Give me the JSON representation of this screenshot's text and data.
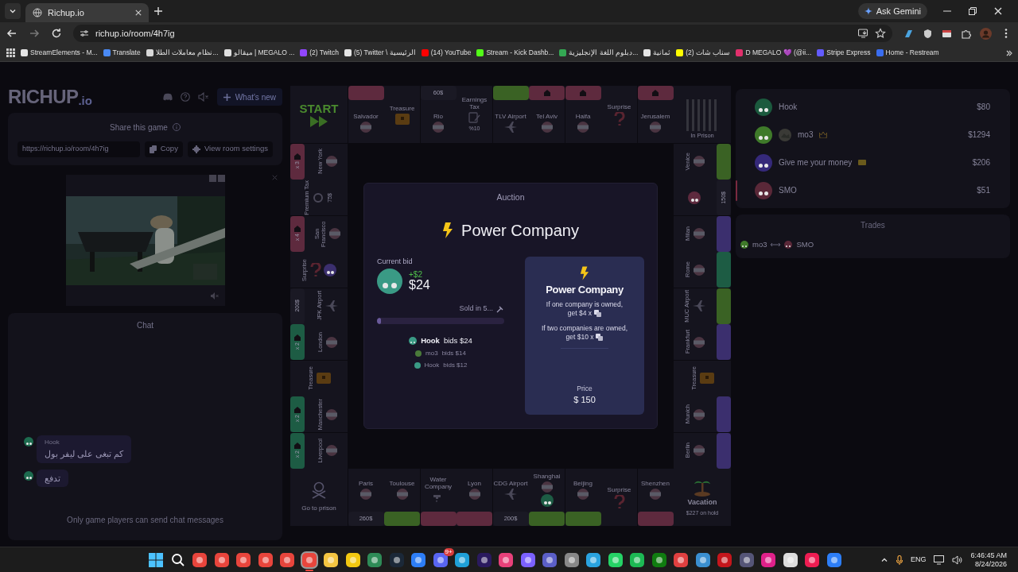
{
  "browser": {
    "tab": {
      "title": "Richup.io",
      "selected": true
    },
    "ask_button": "Ask Gemini",
    "url": "richup.io/room/4h7ig",
    "bookmarks": [
      {
        "label": "StreamElements - M...",
        "color": "#e5e5e5"
      },
      {
        "label": "Translate",
        "color": "#4a8af4"
      },
      {
        "label": "نظام معاملات الطلا...",
        "color": "#d8d8d8"
      },
      {
        "label": "ميقالو | MEGALO ...",
        "color": "#e0e0e0"
      },
      {
        "label": "(2) Twitch",
        "color": "#9146ff"
      },
      {
        "label": "(5) Twitter \\ الرئيسية",
        "color": "#e5e5e5"
      },
      {
        "label": "(14) YouTube",
        "color": "#ff0000"
      },
      {
        "label": "Stream - Kick Dashb...",
        "color": "#53fc18"
      },
      {
        "label": "دبلوم اللغة الإنجليزية...",
        "color": "#34a853"
      },
      {
        "label": "ثمانية",
        "color": "#e5e5e5"
      },
      {
        "label": "(2) سناب شات",
        "color": "#fffc00"
      },
      {
        "label": "D MEGALO 💜 (@ii...",
        "color": "#e1306c"
      },
      {
        "label": "Stripe Express",
        "color": "#635bff"
      },
      {
        "label": "Home - Restream",
        "color": "#3a6df0"
      }
    ]
  },
  "app": {
    "logo": {
      "main": "RICHUP",
      "suffix": ".io"
    },
    "whats_new": "What's new",
    "share": {
      "title": "Share this game",
      "url": "https://richup.io/room/4h7ig",
      "copy": "Copy",
      "settings": "View room settings"
    },
    "chat": {
      "title": "Chat",
      "messages": [
        {
          "author": "Hook",
          "text": "كم تبغى على ليفر بول",
          "color": "#1d6b4f"
        },
        {
          "text": "تدفع",
          "color": "#1d6b4f"
        }
      ],
      "notice": "Only game players can send chat messages"
    },
    "board": {
      "corners": {
        "start": "START",
        "prison": "In Prison",
        "go_to_prison": "Go to prison",
        "vacation": "Vacation",
        "vacation_note": "$227 on hold"
      },
      "top": [
        {
          "name": "Salvador",
          "band": {
            "color": "#5e2a3e",
            "house": false
          },
          "kind": "flag"
        },
        {
          "name": "Treasure",
          "kind": "chest"
        },
        {
          "name": "Rio",
          "band": {
            "text": "60$",
            "house": false
          },
          "kind": "flag"
        },
        {
          "name": "Earnings Tax",
          "kind": "tax",
          "note": "%10"
        },
        {
          "name": "TLV Airport",
          "band": {
            "color": "#3a6224",
            "house": false
          },
          "kind": "plane"
        },
        {
          "name": "Tel Aviv",
          "band": {
            "color": "#5e2a3e",
            "house": true
          },
          "kind": "flag"
        },
        {
          "name": "Haifa",
          "band": {
            "color": "#5e2a3e",
            "house": true
          },
          "kind": "flag"
        },
        {
          "name": "Surprise",
          "kind": "question"
        },
        {
          "name": "Jerusalem",
          "band": {
            "color": "#5e2a3e",
            "house": true
          },
          "kind": "flag"
        }
      ],
      "left": [
        {
          "name": "New York",
          "band": {
            "color": "#5e2a3e",
            "house": true,
            "text": "x 3"
          },
          "kind": "flag"
        },
        {
          "name": "Premium Tax",
          "kind": "ring",
          "note": "75$"
        },
        {
          "name": "San Francisco",
          "band": {
            "color": "#5e2a3e",
            "house": true,
            "text": "x 4"
          },
          "kind": "flag"
        },
        {
          "name": "Surprise",
          "kind": "question",
          "token": {
            "color": "#3b2f6e"
          }
        },
        {
          "name": "JFK Airport",
          "band": {
            "text": "200$",
            "house": false
          },
          "kind": "plane"
        },
        {
          "name": "London",
          "band": {
            "color": "#1d5c44",
            "house": true,
            "text": "x 2"
          },
          "kind": "flag"
        },
        {
          "name": "Treasure",
          "kind": "chest"
        },
        {
          "name": "Manchester",
          "band": {
            "color": "#1d5c44",
            "house": true,
            "text": "x 2"
          },
          "kind": "flag"
        },
        {
          "name": "Liverpool",
          "band": {
            "color": "#1d5c44",
            "house": true,
            "text": "x 2"
          },
          "kind": "flag"
        }
      ],
      "right": [
        {
          "name": "Venice",
          "band": {
            "color": "#3a6224",
            "house": false
          },
          "kind": "flag"
        },
        {
          "band": {
            "text": "150$",
            "house": false
          },
          "token": {
            "color": "#5e2a3e"
          }
        },
        {
          "name": "Milan",
          "band": {
            "color": "#3b2f6e",
            "house": false
          },
          "kind": "flag"
        },
        {
          "name": "Rome",
          "band": {
            "color": "#1d5c44",
            "house": false
          },
          "kind": "flag"
        },
        {
          "name": "MUC Airport",
          "band": {
            "color": "#3a6224",
            "house": false
          },
          "kind": "plane"
        },
        {
          "name": "Frankfurt",
          "band": {
            "color": "#3b2f6e",
            "house": false
          },
          "kind": "flag"
        },
        {
          "name": "Treasure",
          "kind": "chest"
        },
        {
          "name": "Munich",
          "band": {
            "color": "#3b2f6e",
            "house": false
          },
          "kind": "flag"
        },
        {
          "name": "Berlin",
          "band": {
            "color": "#3b2f6e",
            "house": false
          },
          "kind": "flag"
        }
      ],
      "bottom": [
        {
          "name": "Paris",
          "band": {
            "text": "260$",
            "house": false
          },
          "kind": "flag"
        },
        {
          "name": "Toulouse",
          "band": {
            "color": "#3a6224",
            "house": false
          },
          "kind": "flag"
        },
        {
          "name": "Water Company",
          "band": {
            "color": "#5e2a3e",
            "house": false
          },
          "kind": "water"
        },
        {
          "name": "Lyon",
          "band": {
            "color": "#5e2a3e",
            "house": false
          },
          "kind": "flag"
        },
        {
          "name": "CDG Airport",
          "band": {
            "text": "200$",
            "house": false
          },
          "kind": "plane"
        },
        {
          "name": "Shanghai",
          "band": {
            "color": "#3a6224",
            "house": false
          },
          "kind": "flag",
          "token": {
            "color": "#1d5c44"
          }
        },
        {
          "name": "Beijing",
          "band": {
            "color": "#3a6224",
            "house": false
          },
          "kind": "flag"
        },
        {
          "name": "Surprise",
          "kind": "question"
        },
        {
          "name": "Shenzhen",
          "band": {
            "color": "#5e2a3e",
            "house": false
          },
          "kind": "flag"
        }
      ]
    },
    "auction": {
      "heading": "Auction",
      "title": "Power Company",
      "current_bid_label": "Current bid",
      "bidder": {
        "color": "#3a9a85"
      },
      "increment": "+$2",
      "amount": "$24",
      "timer": "Sold in 5...",
      "level": 0.03,
      "bids": [
        {
          "name": "Hook",
          "text": "bids $24",
          "color": "#3a9a85",
          "latest": true
        },
        {
          "name": "mo3",
          "text": "bids $14",
          "color": "#4a7a3a",
          "latest": false
        },
        {
          "name": "Hook",
          "text": "bids $12",
          "color": "#3a9a85",
          "latest": false
        }
      ],
      "card": {
        "title": "Power Company",
        "rules": [
          "If one company is owned,",
          "get $4 x",
          "If two companies are owned,",
          "get $10 x"
        ],
        "price_label": "Price",
        "price": "$ 150"
      }
    },
    "players": [
      {
        "name": "Hook",
        "money": "$80",
        "color": "#1b5a3e",
        "current": false,
        "kind": "plain"
      },
      {
        "name": "mo3",
        "money": "$1294",
        "color": "#3f7a2a",
        "current": false,
        "kind": "host"
      },
      {
        "name": "Give me your money",
        "money": "$206",
        "color": "#35297a",
        "current": false,
        "kind": "tagged"
      },
      {
        "name": "SMO",
        "money": "$51",
        "color": "#5a2838",
        "current": true,
        "kind": "plain"
      }
    ],
    "trades": {
      "title": "Trades",
      "items": [
        {
          "from": {
            "name": "mo3",
            "color": "#3f7a2a"
          },
          "to": {
            "name": "SMO",
            "color": "#5a2838"
          }
        }
      ]
    }
  },
  "taskbar": {
    "apps": [
      {
        "kind": "start",
        "color": "#4cc2ff"
      },
      {
        "kind": "search",
        "color": "#ffffff"
      },
      {
        "kind": "app",
        "color": "#e8453c"
      },
      {
        "kind": "app",
        "color": "#e8453c"
      },
      {
        "kind": "app",
        "color": "#e8453c"
      },
      {
        "kind": "app",
        "color": "#e8453c"
      },
      {
        "kind": "app",
        "color": "#e8453c"
      },
      {
        "kind": "app",
        "color": "#e8453c",
        "active": true
      },
      {
        "kind": "app",
        "color": "#f4c542"
      },
      {
        "kind": "app",
        "color": "#f2c811"
      },
      {
        "kind": "app",
        "color": "#2e8b57"
      },
      {
        "kind": "app",
        "color": "#1b2838"
      },
      {
        "kind": "app",
        "color": "#2d7ef7"
      },
      {
        "kind": "app",
        "color": "#5865f2",
        "badge": "9+"
      },
      {
        "kind": "app",
        "color": "#1fa0d8"
      },
      {
        "kind": "app",
        "color": "#2a1a5e"
      },
      {
        "kind": "app",
        "color": "#e8417a"
      },
      {
        "kind": "app",
        "color": "#7b61ff"
      },
      {
        "kind": "app",
        "color": "#5b5fc7"
      },
      {
        "kind": "app",
        "color": "#888888"
      },
      {
        "kind": "app",
        "color": "#2aa3df"
      },
      {
        "kind": "app",
        "color": "#25d366"
      },
      {
        "kind": "app",
        "color": "#1db954"
      },
      {
        "kind": "app",
        "color": "#107c10"
      },
      {
        "kind": "app",
        "color": "#e04040"
      },
      {
        "kind": "app",
        "color": "#3a8fd0"
      },
      {
        "kind": "app",
        "color": "#c4161c"
      },
      {
        "kind": "app",
        "color": "#555577"
      },
      {
        "kind": "app",
        "color": "#e0218a"
      },
      {
        "kind": "app",
        "color": "#dddddd"
      },
      {
        "kind": "app",
        "color": "#ee1d52"
      },
      {
        "kind": "app",
        "color": "#2d7ef7"
      }
    ],
    "language": "ENG",
    "time": "6:46:45 AM",
    "date": "8/24/2026"
  }
}
